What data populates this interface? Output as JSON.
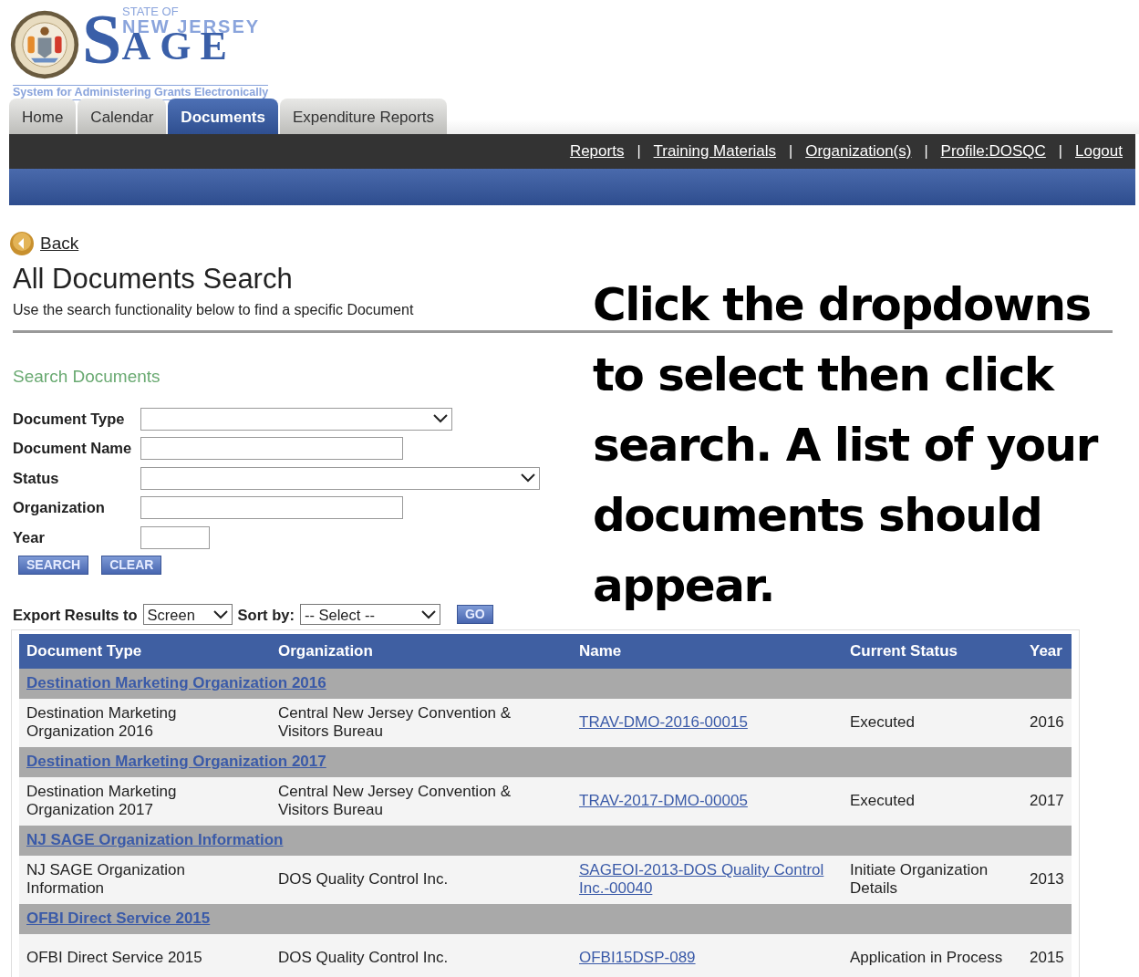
{
  "logo": {
    "state_of": "STATE OF",
    "state": "NEW JERSEY",
    "big_letter": "S",
    "rest": "AGE",
    "tagline": "System for Administering Grants Electronically"
  },
  "tabs": [
    {
      "label": "Home",
      "selected": false
    },
    {
      "label": "Calendar",
      "selected": false
    },
    {
      "label": "Documents",
      "selected": true
    },
    {
      "label": "Expenditure Reports",
      "selected": false
    }
  ],
  "top_links": [
    "Reports",
    "Training Materials",
    "Organization(s)",
    "Profile:DOSQC",
    "Logout"
  ],
  "link_separator": "|",
  "back_link": "Back",
  "page_title": "All Documents Search",
  "subtitle": "Use the search functionality below to find a specific Document",
  "section_title": "Search Documents",
  "form_fields": [
    {
      "label": "Document Type",
      "kind": "select"
    },
    {
      "label": "Document Name",
      "kind": "text"
    },
    {
      "label": "Status",
      "kind": "select"
    },
    {
      "label": "Organization",
      "kind": "text"
    },
    {
      "label": "Year",
      "kind": "text"
    }
  ],
  "form_buttons": [
    "SEARCH",
    "CLEAR"
  ],
  "export": {
    "label": "Export Results to",
    "value": "Screen"
  },
  "sort": {
    "label": "Sort by:",
    "value": "-- Select --"
  },
  "go_button": "GO",
  "annotation": "Click the dropdowns to select then click search. A list of your documents should appear.",
  "table": {
    "columns": [
      "Document Type",
      "Organization",
      "Name",
      "Current Status",
      "Year"
    ],
    "groups": [
      {
        "title": "Destination Marketing Organization 2016",
        "rows": [
          [
            "Destination Marketing Organization 2016",
            "Central New Jersey Convention & Visitors Bureau",
            "TRAV-DMO-2016-00015",
            "Executed",
            "2016"
          ]
        ]
      },
      {
        "title": "Destination Marketing Organization 2017",
        "rows": [
          [
            "Destination Marketing Organization 2017",
            "Central New Jersey Convention & Visitors Bureau",
            "TRAV-2017-DMO-00005",
            "Executed",
            "2017"
          ]
        ]
      },
      {
        "title": "NJ SAGE Organization Information",
        "rows": [
          [
            "NJ SAGE Organization Information",
            "DOS Quality Control Inc.",
            "SAGEOI-2013-DOS Quality Control Inc.-00040",
            "Initiate Organization Details",
            "2013"
          ]
        ]
      },
      {
        "title": "OFBI Direct Service 2015",
        "rows": [
          [
            "OFBI Direct Service 2015",
            "DOS Quality Control Inc.",
            "OFBI15DSP-089",
            "Application in Process",
            "2015"
          ]
        ]
      }
    ]
  }
}
